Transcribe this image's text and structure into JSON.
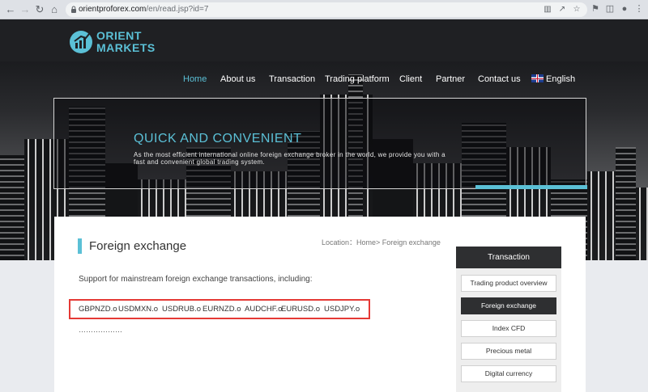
{
  "browser": {
    "back_icon": "arrow-left-icon",
    "forward_icon": "arrow-right-icon",
    "reload_icon": "reload-icon",
    "home_icon": "home-icon",
    "url_host": "orientproforex.com",
    "url_path": "/en/read.jsp?id=7"
  },
  "site": {
    "logo_line1": "ORIENT",
    "logo_line2": "MARKETS",
    "accent_color": "#5bc0d6"
  },
  "menu": {
    "items": [
      {
        "label": "Home",
        "active": true
      },
      {
        "label": "About us"
      },
      {
        "label": "Transaction"
      },
      {
        "label": "Trading platform"
      },
      {
        "label": "Client"
      },
      {
        "label": "Partner"
      },
      {
        "label": "Contact us"
      },
      {
        "label": "English"
      }
    ]
  },
  "banner": {
    "title": "QUICK AND CONVENIENT",
    "text": "As the most efficient international online foreign exchange broker in the world, we provide you with a fast and convenient global trading system."
  },
  "content": {
    "page_title": "Foreign exchange",
    "breadcrumb": "Location：Home> Foreign exchange",
    "intro": "Support for mainstream foreign exchange transactions, including:",
    "pairs": [
      "GBPNZD.o",
      "USDMXN.o",
      "USDRUB.o",
      "EURNZD.o",
      "AUDCHF.o",
      "EURUSD.o",
      "USDJPY.o"
    ],
    "more": "………………"
  },
  "sidebar": {
    "heading": "Transaction",
    "items": [
      {
        "label": "Trading product overview"
      },
      {
        "label": "Foreign exchange",
        "active": true
      },
      {
        "label": "Index CFD"
      },
      {
        "label": "Precious metal"
      },
      {
        "label": "Digital currency"
      }
    ]
  }
}
